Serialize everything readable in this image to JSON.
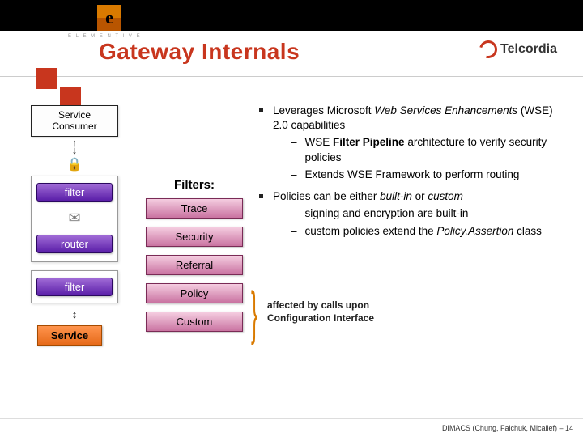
{
  "header": {
    "elementive_label": "E L E M E N T I V E",
    "e_glyph": "e",
    "title": "Gateway Internals",
    "brand": "Telcordia"
  },
  "left": {
    "service_consumer_l1": "Service",
    "service_consumer_l2": "Consumer",
    "filter": "filter",
    "router": "router",
    "filter2": "filter",
    "service": "Service"
  },
  "filters": {
    "heading": "Filters:",
    "items": [
      "Trace",
      "Security",
      "Referral",
      "Policy",
      "Custom"
    ]
  },
  "bullets": {
    "b1_pre": "Leverages Microsoft ",
    "b1_it": "Web Services Enhancements",
    "b1_post": " (WSE) 2.0 capabilities",
    "b1_s1_pre": "WSE ",
    "b1_s1_bold": "Filter Pipeline",
    "b1_s1_post": " architecture to verify security policies",
    "b1_s2": "Extends WSE Framework to perform routing",
    "b2_pre": "Policies can be either ",
    "b2_it1": "built-in",
    "b2_mid": " or ",
    "b2_it2": "custom",
    "b2_s1": "signing and encryption are built-in",
    "b2_s2_pre": "custom policies extend the ",
    "b2_s2_it": "Policy.Assertion",
    "b2_s2_post": " class"
  },
  "affected": {
    "l1": "affected by calls upon",
    "l2": "Configuration Interface"
  },
  "footer": "DIMACS (Chung, Falchuk, Micallef) – 14"
}
